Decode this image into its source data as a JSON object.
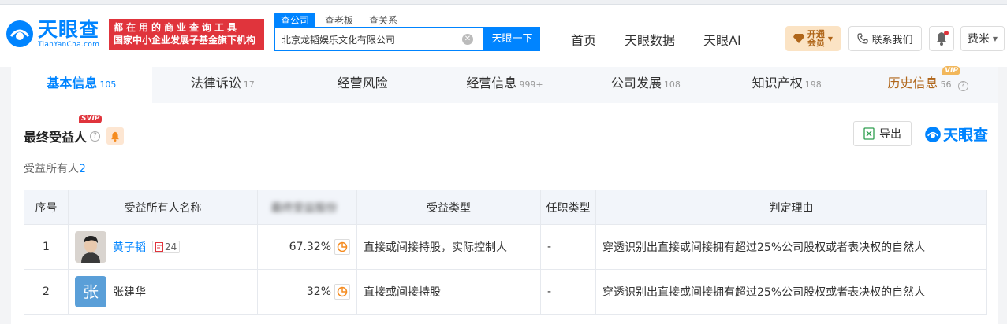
{
  "header": {
    "logo_cn": "天眼查",
    "logo_en": "TianYanCha.com",
    "promo_line1": "都在用的商业查询工具",
    "promo_line2": "国家中小企业发展子基金旗下机构",
    "search_tabs": [
      "查公司",
      "查老板",
      "查关系"
    ],
    "search_value": "北京龙韬娱乐文化有限公司",
    "search_button": "天眼一下",
    "nav": [
      "首页",
      "天眼数据",
      "天眼AI"
    ],
    "vip_label_1": "开通",
    "vip_label_2": "会员",
    "contact": "联系我们",
    "user": "费米"
  },
  "tabs": [
    {
      "label": "基本信息",
      "count": "105"
    },
    {
      "label": "法律诉讼",
      "count": "17"
    },
    {
      "label": "经营风险",
      "count": ""
    },
    {
      "label": "经营信息",
      "count": "999+"
    },
    {
      "label": "公司发展",
      "count": "108"
    },
    {
      "label": "知识产权",
      "count": "198"
    },
    {
      "label": "历史信息",
      "count": "56"
    }
  ],
  "history_vip_tag": "VIP",
  "section": {
    "title": "最终受益人",
    "svip": "SVIP",
    "export": "导出",
    "logo": "天眼查",
    "owner_label": "受益所有人",
    "owner_count": "2"
  },
  "table": {
    "headers": [
      "序号",
      "受益所有人名称",
      "最终受益股份",
      "受益类型",
      "任职类型",
      "判定理由"
    ],
    "rows": [
      {
        "idx": "1",
        "name": "黄子韬",
        "related": "24",
        "ratio": "67.32%",
        "type": "直接或间接持股，实际控制人",
        "position": "-",
        "reason": "穿透识别出直接或间接拥有超过25%公司股权或者表决权的自然人"
      },
      {
        "idx": "2",
        "name": "张建华",
        "avatar_char": "张",
        "ratio": "32%",
        "type": "直接或间接持股",
        "position": "-",
        "reason": "穿透识别出直接或间接拥有超过25%公司股权或者表决权的自然人"
      }
    ]
  }
}
